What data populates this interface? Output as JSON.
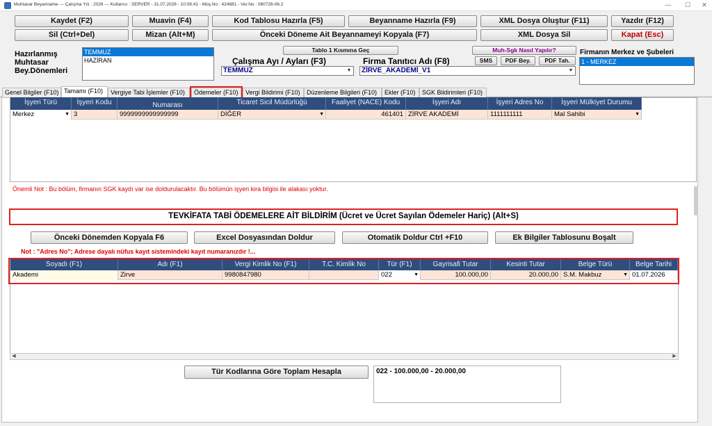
{
  "titlebar": {
    "text": "Muhtasar Beyanname  ---  Çalışma Yılı : 2026  ---  Kullanıcı : SERVER - 31.07.2026 - 10:08:41  -  Müş.No : 424681  -  Ver.No : 060726-06.2",
    "minimize": "—",
    "maximize": "☐",
    "close": "✕"
  },
  "toolbar": {
    "row1": [
      "Kaydet (F2)",
      "Muavin (F4)",
      "Kod Tablosu Hazırla (F5)",
      "Beyanname Hazırla (F9)",
      "XML Dosya Oluştur (F11)",
      "Yazdır (F12)"
    ],
    "row2": [
      "Sil (Ctrl+Del)",
      "Mizan (Alt+M)",
      "Önceki Döneme Ait Beyannameyi Kopyala (F7)",
      "XML Dosya Sil",
      "Kapat (Esc)"
    ]
  },
  "periods": {
    "label": "Hazırlanmış Muhtasar Bey.Dönemleri",
    "label_l1": "Hazırlanmış",
    "label_l2": "Muhtasar",
    "label_l3": "Bey.Dönemleri",
    "items": [
      "TEMMUZ",
      "HAZİRAN"
    ]
  },
  "tablo_button": "Tablo 1 Kısmına Geç",
  "calisma": {
    "label": "Çalışma Ayı / Ayları (F3)",
    "value": "TEMMUZ"
  },
  "firma": {
    "label": "Firma Tanıtıcı Adı (F8)",
    "value": "ZİRVE_AKADEMİ_V1"
  },
  "help_buttons": {
    "muh_sgk": "Muh-Sgk Nasıl Yapılır?",
    "sms": "SMS",
    "pdf_bey": "PDF Bey.",
    "pdf_tah": "PDF Tah."
  },
  "branches": {
    "label": "Firmanın Merkez ve Şubeleri",
    "items": [
      "1 - MERKEZ"
    ]
  },
  "tabs": [
    "Genel Bilgiler (F10)",
    "Tamamı (F10)",
    "Vergiye Tabi İşlemler (F10)",
    "Ödemeler (F10)",
    "Vergi Bildirimi (F10)",
    "Düzenleme Bilgileri (F10)",
    "Ekler (F10)",
    "SGK Bildirimleri (F10)"
  ],
  "sgk_grid": {
    "headers": [
      "İşyeri Türü",
      "İşyeri Kodu",
      "Numarası",
      "Ticaret Sicil Müdürlüğü",
      "Faaliyet (NACE) Kodu",
      "İşyeri Adı",
      "İşyeri Adres No",
      "İşyeri Mülkiyet Durumu"
    ],
    "row": [
      "Merkez",
      "3",
      "9999999999999999",
      "DİĞER",
      "461401",
      "ZİRVE AKADEMİ",
      "1111111111",
      "Mal Sahibi"
    ]
  },
  "notes": {
    "sgk": "Önemli Not : Bu bölüm, firmanın SGK kaydı var ise doldurulacaktır. Bu bölümün işyeri kira bilgisi ile alakası yoktur.",
    "adres": "Not : \"Adres No\"; Adrese dayalı nüfus kayıt sistemindeki kayıt numaranızdır !..."
  },
  "section_title": "TEVKİFATA TABİ ÖDEMELERE AİT BİLDİRİM (Ücret ve Ücret Sayılan Ödemeler Hariç) (Alt+S)",
  "action_buttons": [
    "Önceki Dönemden Kopyala F6",
    "Excel Dosyasından Doldur",
    "Otomatik Doldur  Ctrl +F10",
    "Ek Bilgiler Tablosunu Boşalt"
  ],
  "pay_grid": {
    "headers": [
      "Soyadı (F1)",
      "Adı (F1)",
      "Vergi Kimlik No (F1)",
      "T.C. Kimlik No",
      "Tür (F1)",
      "Gayrisafi Tutar",
      "Kesinti Tutar",
      "Belge Türü",
      "Belge Tarihi"
    ],
    "row": [
      "Akademi",
      "Zirve",
      "9980847980",
      "",
      "022",
      "100.000,00",
      "20.000,00",
      "S.M. Makbuz",
      "01.07.2026"
    ]
  },
  "total_button": "Tür Kodlarına Göre Toplam Hesapla",
  "total_text": "022 - 100.000,00 - 20.000,00"
}
